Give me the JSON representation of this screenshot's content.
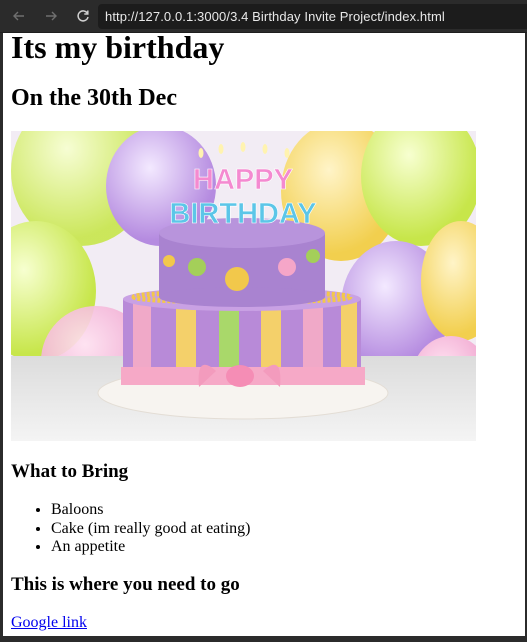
{
  "browser": {
    "url": "http://127.0.0.1:3000/3.4 Birthday Invite Project/index.html"
  },
  "page": {
    "title": "Its my birthday",
    "subtitle": "On the 30th Dec",
    "image_text": "HAPPY BIRTHDAY",
    "bring_heading": "What to Bring",
    "bring_items": [
      "Baloons",
      "Cake (im really good at eating)",
      "An appetite"
    ],
    "where_heading": "This is where you need to go",
    "link_text": "Google link"
  }
}
